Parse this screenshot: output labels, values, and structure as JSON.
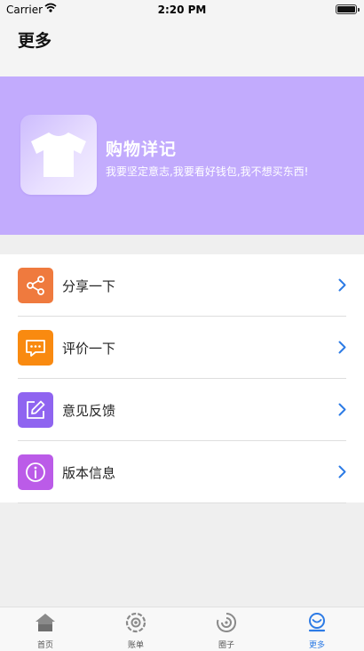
{
  "status_bar": {
    "carrier": "Carrier",
    "time": "2:20 PM"
  },
  "page": {
    "title": "更多"
  },
  "banner": {
    "app_name": "购物详记",
    "slogan": "我要坚定意志,我要看好钱包,我不想买东西!",
    "background_color": "#c2abfd",
    "logo_icon": "tshirt-icon"
  },
  "menu": {
    "items": [
      {
        "label": "分享一下",
        "icon": "share-icon",
        "color": "#ef7a3e"
      },
      {
        "label": "评价一下",
        "icon": "message-icon",
        "color": "#f98a10"
      },
      {
        "label": "意见反馈",
        "icon": "edit-icon",
        "color": "#8f64f0"
      },
      {
        "label": "版本信息",
        "icon": "info-icon",
        "color": "#bb5be8"
      }
    ],
    "chevron_color": "#2d7be5"
  },
  "tab_bar": {
    "tabs": [
      {
        "label": "首页",
        "icon": "home-icon",
        "active": false
      },
      {
        "label": "账单",
        "icon": "bill-icon",
        "active": false
      },
      {
        "label": "圈子",
        "icon": "circle-icon",
        "active": false
      },
      {
        "label": "更多",
        "icon": "more-icon",
        "active": true
      }
    ],
    "active_color": "#2d7be5"
  }
}
